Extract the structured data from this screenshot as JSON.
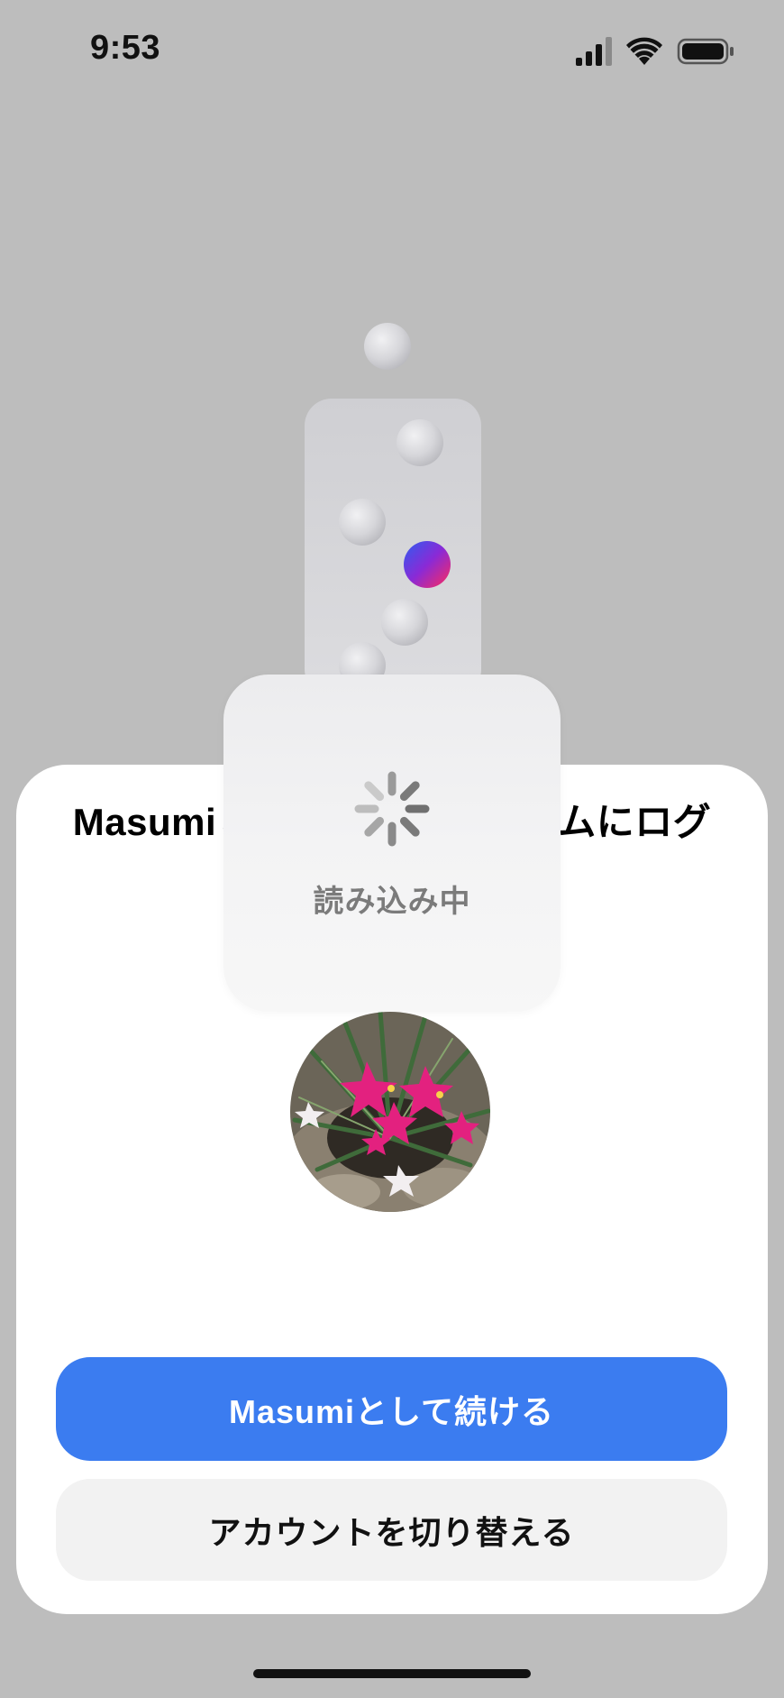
{
  "status_bar": {
    "time": "9:53"
  },
  "sheet": {
    "title": "Masumiとしてインスタグラムにログ",
    "primary_button": "Masumiとして続ける",
    "secondary_button": "アカウントを切り替える"
  },
  "loading": {
    "label": "読み込み中"
  },
  "colors": {
    "primary": "#3b7cf0",
    "backdrop": "#bdbdbd"
  },
  "icons": {
    "signal": "cellular-signal-icon",
    "wifi": "wifi-icon",
    "battery": "battery-icon",
    "spinner": "loading-spinner-icon"
  }
}
